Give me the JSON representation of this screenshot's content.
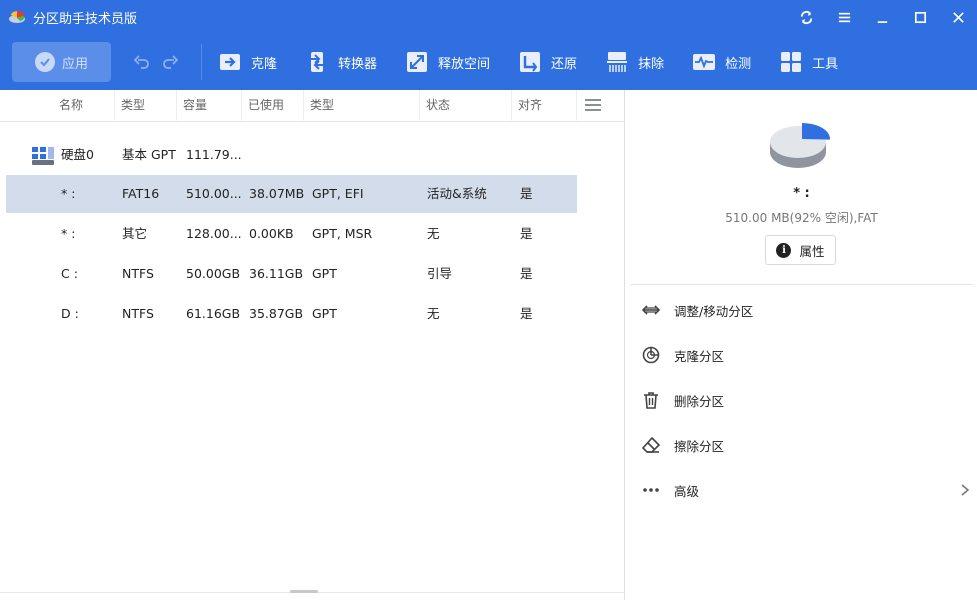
{
  "app": {
    "title": "分区助手技术员版"
  },
  "toolbar": {
    "apply_label": "应用",
    "items": [
      {
        "label": "克隆",
        "icon": "clone-icon"
      },
      {
        "label": "转换器",
        "icon": "convert-icon"
      },
      {
        "label": "释放空间",
        "icon": "free-space-icon"
      },
      {
        "label": "还原",
        "icon": "restore-icon"
      },
      {
        "label": "抹除",
        "icon": "wipe-icon"
      },
      {
        "label": "检测",
        "icon": "check-icon"
      },
      {
        "label": "工具",
        "icon": "tools-icon"
      }
    ]
  },
  "table": {
    "headers": [
      "名称",
      "类型",
      "容量",
      "已使用",
      "类型",
      "状态",
      "对齐"
    ],
    "disk": {
      "name": "硬盘0",
      "type": "基本 GPT",
      "capacity": "111.79..."
    },
    "partitions": [
      {
        "name": "* :",
        "type": "FAT16",
        "capacity": "510.00...",
        "used": "38.07MB",
        "fs": "GPT, EFI",
        "status": "活动&系统",
        "align": "是"
      },
      {
        "name": "* :",
        "type": "其它",
        "capacity": "128.00...",
        "used": "0.00KB",
        "fs": "GPT, MSR",
        "status": "无",
        "align": "是"
      },
      {
        "name": "C :",
        "type": "NTFS",
        "capacity": "50.00GB",
        "used": "36.11GB",
        "fs": "GPT",
        "status": "引导",
        "align": "是"
      },
      {
        "name": "D :",
        "type": "NTFS",
        "capacity": "61.16GB",
        "used": "35.87GB",
        "fs": "GPT",
        "status": "无",
        "align": "是"
      }
    ],
    "selected_index": 0
  },
  "details": {
    "name": "* :",
    "info": "510.00 MB(92% 空闲),FAT",
    "properties_label": "属性",
    "free_fraction": 0.92,
    "actions": [
      {
        "label": "调整/移动分区",
        "icon": "resize-move-icon"
      },
      {
        "label": "克隆分区",
        "icon": "clone-partition-icon"
      },
      {
        "label": "删除分区",
        "icon": "trash-icon"
      },
      {
        "label": "擦除分区",
        "icon": "eraser-icon"
      },
      {
        "label": "高级",
        "icon": "more-icon"
      }
    ]
  },
  "colors": {
    "accent": "#2f6fe0",
    "selected_row": "#d3dcea"
  }
}
